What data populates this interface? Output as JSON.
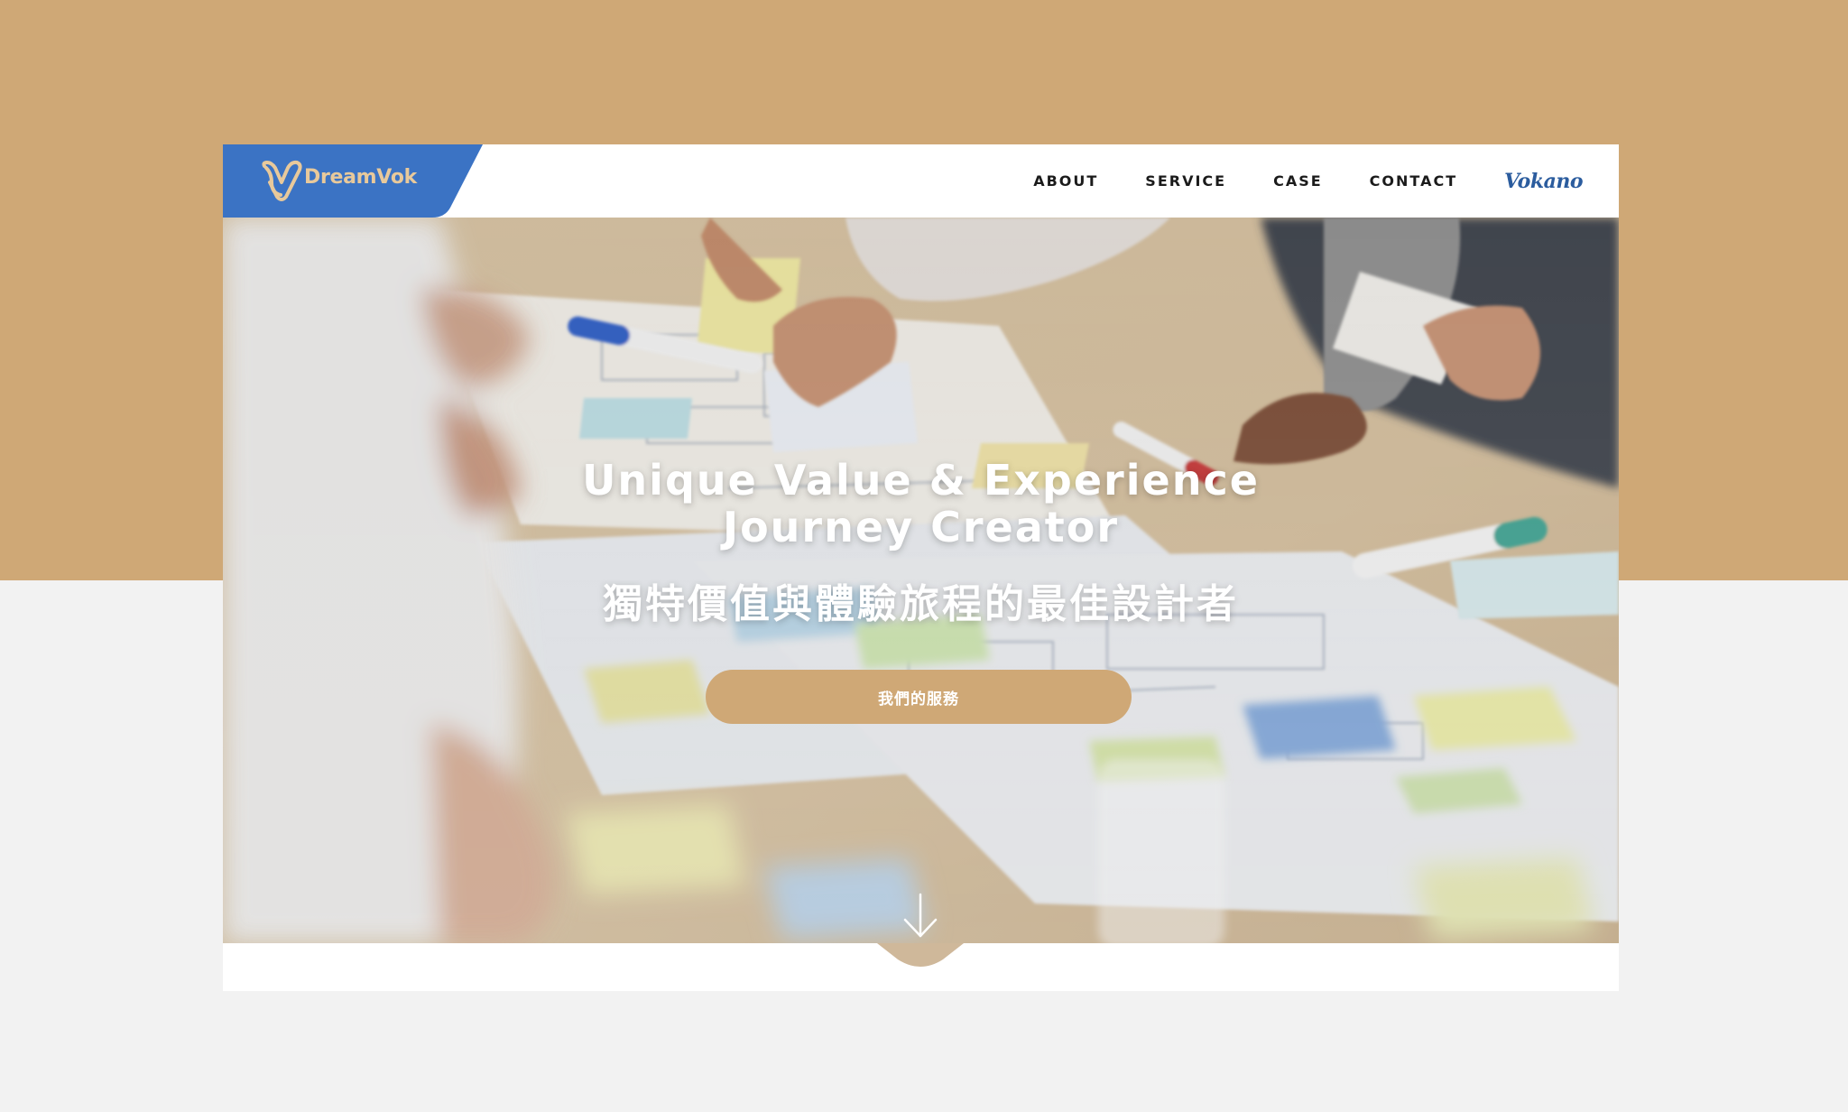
{
  "header": {
    "logo_text": "DreamVok",
    "nav": [
      {
        "label": "ABOUT"
      },
      {
        "label": "SERVICE"
      },
      {
        "label": "CASE"
      },
      {
        "label": "CONTACT"
      }
    ],
    "brand_script": "Vokano"
  },
  "hero": {
    "title_line1": "Unique Value & Experience",
    "title_line2": "Journey Creator",
    "subtitle": "獨特價值與體驗旅程的最佳設計者",
    "cta_label": "我們的服務",
    "scroll_icon": "arrow-down-icon"
  },
  "colors": {
    "accent_gold": "#cfa876",
    "logo_blue": "#3b73c4",
    "brand_blue": "#2b5c9e",
    "page_bg": "#f2f2f2"
  }
}
